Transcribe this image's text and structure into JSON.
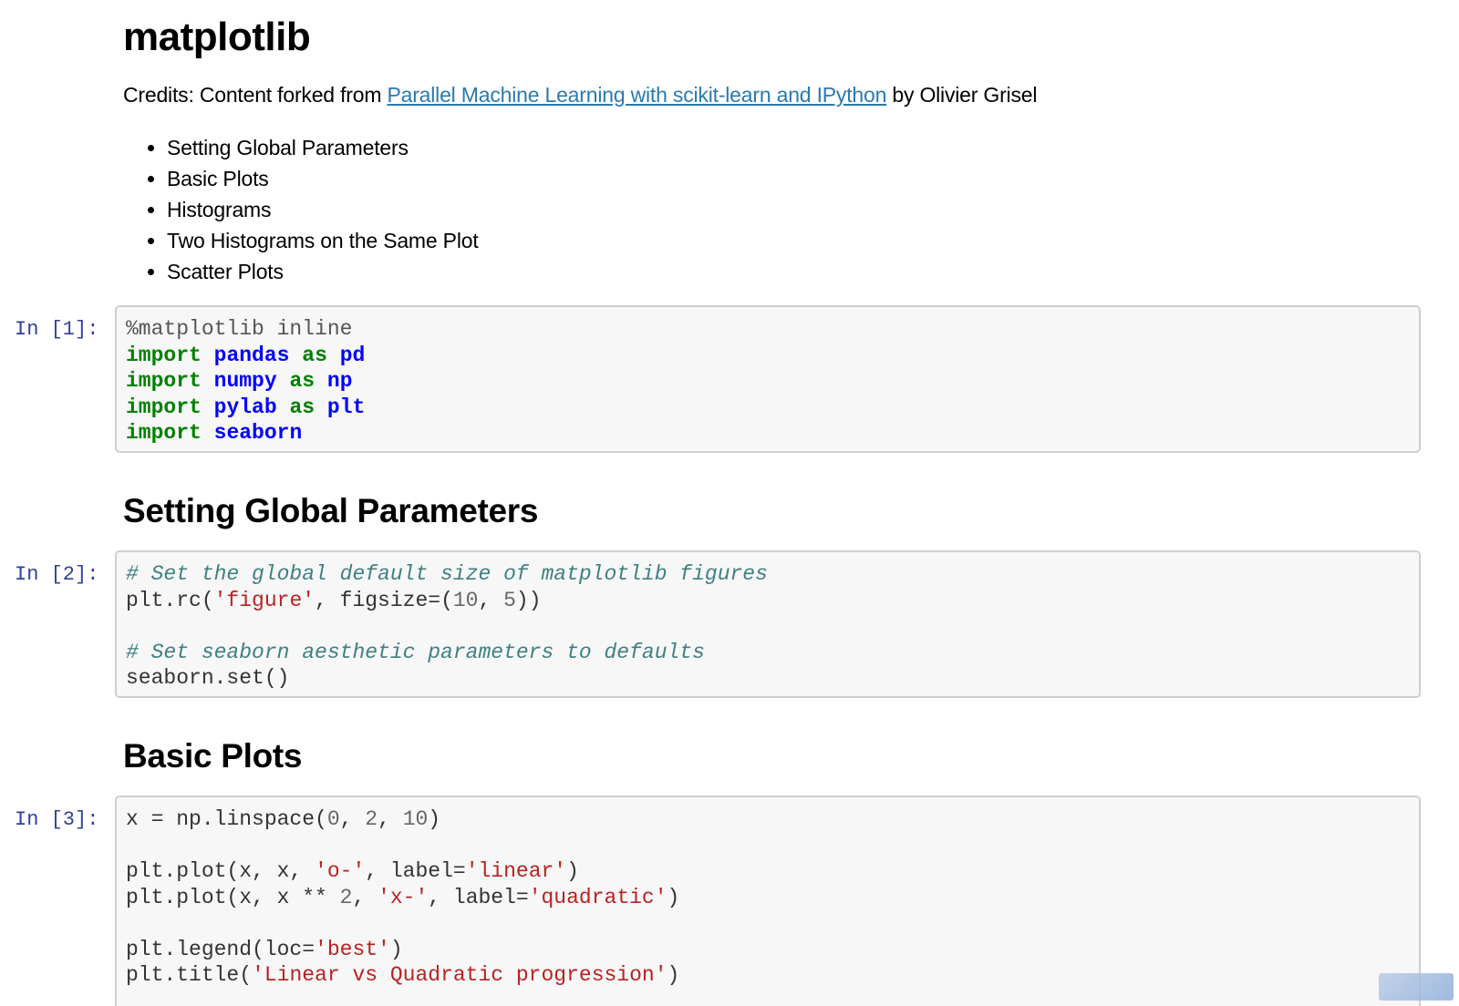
{
  "title": "matplotlib",
  "credits": {
    "prefix": "Credits: Content forked from ",
    "link_text": "Parallel Machine Learning with scikit-learn and IPython",
    "suffix": " by Olivier Grisel"
  },
  "toc": [
    "Setting Global Parameters",
    "Basic Plots",
    "Histograms",
    "Two Histograms on the Same Plot",
    "Scatter Plots"
  ],
  "cells": [
    {
      "prompt": "In [1]:",
      "lines": [
        [
          {
            "t": "%matplotlib inline",
            "c": "mg"
          }
        ],
        [
          {
            "t": "import",
            "c": "kw"
          },
          {
            "t": " ",
            "c": ""
          },
          {
            "t": "pandas",
            "c": "nn"
          },
          {
            "t": " ",
            "c": ""
          },
          {
            "t": "as",
            "c": "kw"
          },
          {
            "t": " ",
            "c": ""
          },
          {
            "t": "pd",
            "c": "nn"
          }
        ],
        [
          {
            "t": "import",
            "c": "kw"
          },
          {
            "t": " ",
            "c": ""
          },
          {
            "t": "numpy",
            "c": "nn"
          },
          {
            "t": " ",
            "c": ""
          },
          {
            "t": "as",
            "c": "kw"
          },
          {
            "t": " ",
            "c": ""
          },
          {
            "t": "np",
            "c": "nn"
          }
        ],
        [
          {
            "t": "import",
            "c": "kw"
          },
          {
            "t": " ",
            "c": ""
          },
          {
            "t": "pylab",
            "c": "nn"
          },
          {
            "t": " ",
            "c": ""
          },
          {
            "t": "as",
            "c": "kw"
          },
          {
            "t": " ",
            "c": ""
          },
          {
            "t": "plt",
            "c": "nn"
          }
        ],
        [
          {
            "t": "import",
            "c": "kw"
          },
          {
            "t": " ",
            "c": ""
          },
          {
            "t": "seaborn",
            "c": "nn"
          }
        ]
      ]
    },
    {
      "prompt": "In [2]:",
      "lines": [
        [
          {
            "t": "# Set the global default size of matplotlib figures",
            "c": "cm"
          }
        ],
        [
          {
            "t": "plt.rc(",
            "c": ""
          },
          {
            "t": "'figure'",
            "c": "str"
          },
          {
            "t": ", figsize=(",
            "c": ""
          },
          {
            "t": "10",
            "c": "num"
          },
          {
            "t": ", ",
            "c": ""
          },
          {
            "t": "5",
            "c": "num"
          },
          {
            "t": "))",
            "c": ""
          }
        ],
        [],
        [
          {
            "t": "# Set seaborn aesthetic parameters to defaults",
            "c": "cm"
          }
        ],
        [
          {
            "t": "seaborn.set()",
            "c": ""
          }
        ]
      ]
    },
    {
      "prompt": "In [3]:",
      "lines": [
        [
          {
            "t": "x = np.linspace(",
            "c": ""
          },
          {
            "t": "0",
            "c": "num"
          },
          {
            "t": ", ",
            "c": ""
          },
          {
            "t": "2",
            "c": "num"
          },
          {
            "t": ", ",
            "c": ""
          },
          {
            "t": "10",
            "c": "num"
          },
          {
            "t": ")",
            "c": ""
          }
        ],
        [],
        [
          {
            "t": "plt.plot(x, x, ",
            "c": ""
          },
          {
            "t": "'o-'",
            "c": "str"
          },
          {
            "t": ", label=",
            "c": ""
          },
          {
            "t": "'linear'",
            "c": "str"
          },
          {
            "t": ")",
            "c": ""
          }
        ],
        [
          {
            "t": "plt.plot(x, x ** ",
            "c": ""
          },
          {
            "t": "2",
            "c": "num"
          },
          {
            "t": ", ",
            "c": ""
          },
          {
            "t": "'x-'",
            "c": "str"
          },
          {
            "t": ", label=",
            "c": ""
          },
          {
            "t": "'quadratic'",
            "c": "str"
          },
          {
            "t": ")",
            "c": ""
          }
        ],
        [],
        [
          {
            "t": "plt.legend(loc=",
            "c": ""
          },
          {
            "t": "'best'",
            "c": "str"
          },
          {
            "t": ")",
            "c": ""
          }
        ],
        [
          {
            "t": "plt.title(",
            "c": ""
          },
          {
            "t": "'Linear vs Quadratic progression'",
            "c": "str"
          },
          {
            "t": ")",
            "c": ""
          }
        ]
      ]
    }
  ],
  "sections": [
    "Setting Global Parameters",
    "Basic Plots"
  ]
}
